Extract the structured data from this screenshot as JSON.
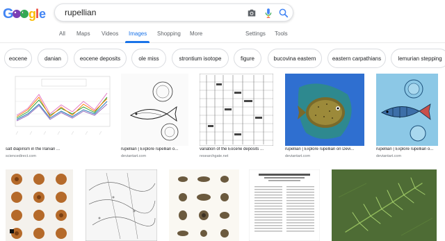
{
  "search": {
    "query": "rupellian"
  },
  "tabs": [
    {
      "label": "All"
    },
    {
      "label": "Maps"
    },
    {
      "label": "Videos"
    },
    {
      "label": "Images"
    },
    {
      "label": "Shopping"
    },
    {
      "label": "More"
    },
    {
      "label": "Settings"
    },
    {
      "label": "Tools"
    }
  ],
  "chips": [
    {
      "label": "eocene"
    },
    {
      "label": "danian"
    },
    {
      "label": "eocene deposits"
    },
    {
      "label": "ole miss"
    },
    {
      "label": "strontium isotope"
    },
    {
      "label": "figure"
    },
    {
      "label": "bucovina eastern"
    },
    {
      "label": "eastern carpathians"
    },
    {
      "label": "lemurian stepping"
    }
  ],
  "results": [
    {
      "caption": "salt diapirism in the Iranian ...",
      "source": "sciencedirect.com"
    },
    {
      "caption": "rupellian | Explore rupellian o...",
      "source": "deviantart.com"
    },
    {
      "caption": "variation of the Eocene deposits ...",
      "source": "researchgate.net"
    },
    {
      "caption": "rupellian | Explore rupellian on Devi...",
      "source": "deviantart.com"
    },
    {
      "caption": "rupellian | Explore rupellian o...",
      "source": "deviantart.com"
    }
  ],
  "icons": {
    "camera": "camera-icon",
    "mic": "microphone-icon",
    "search": "search-icon"
  },
  "colors": {
    "accent": "#1a73e8",
    "tab_text": "#5f6368"
  }
}
